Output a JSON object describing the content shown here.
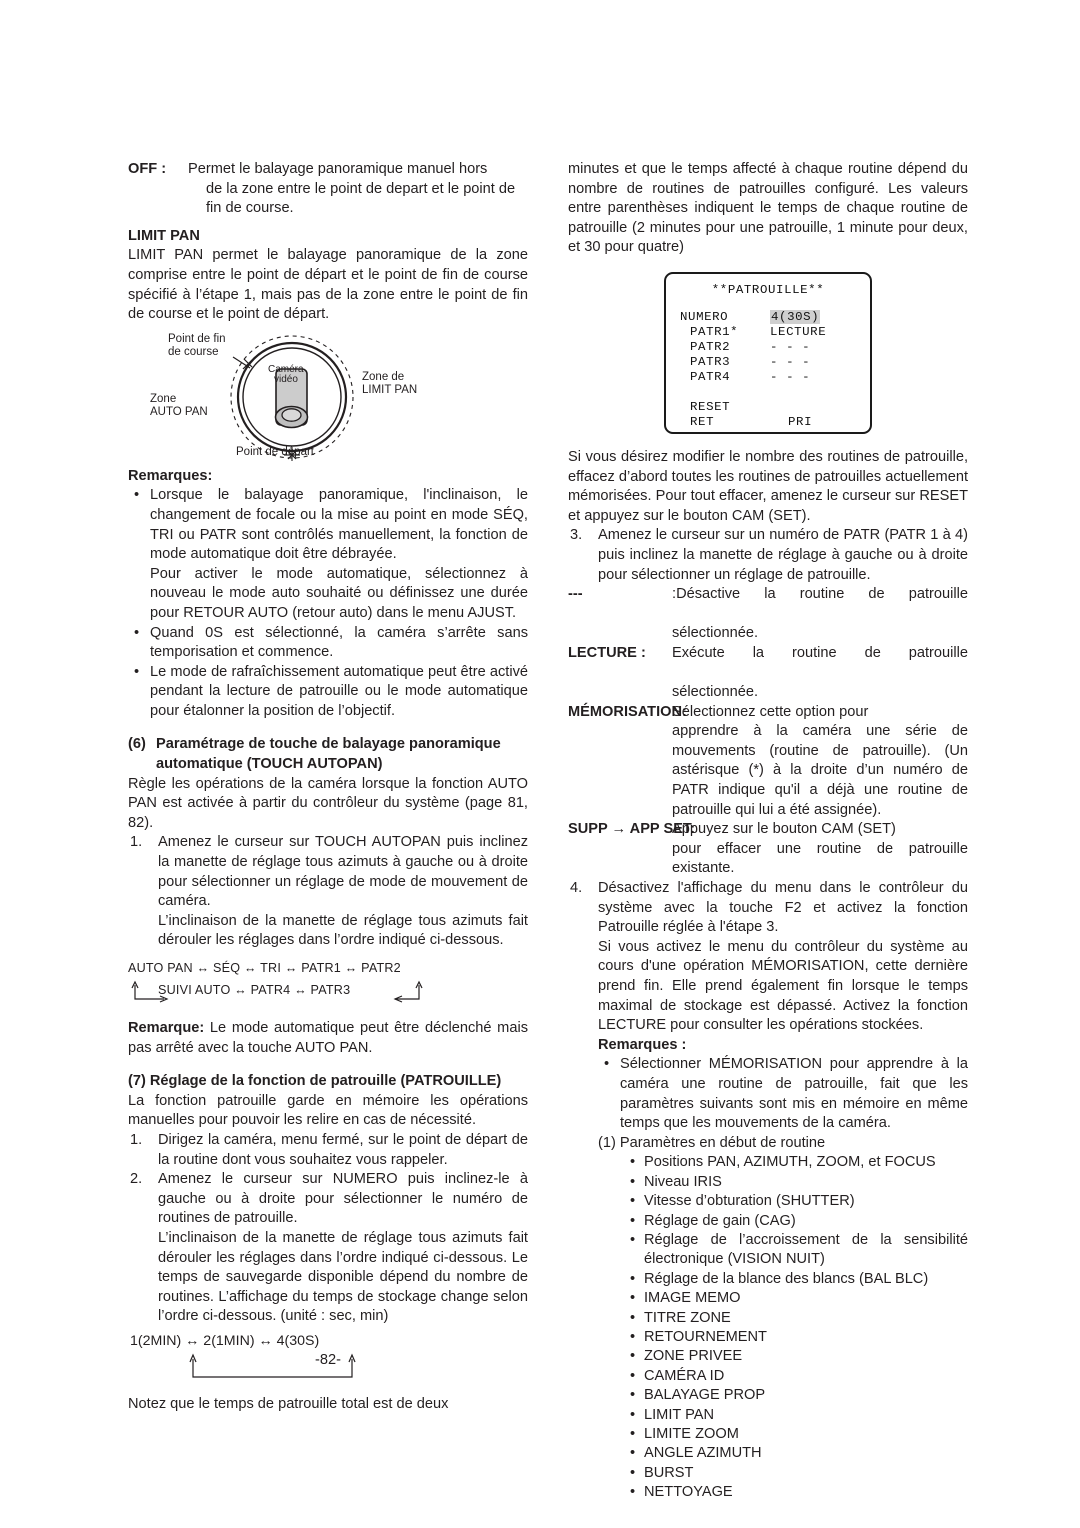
{
  "page_number": "-82-",
  "left_column": {
    "off_definition": {
      "term": "OFF :",
      "line1": "Permet le balayage panoramique manuel hors",
      "line2": "de la zone entre le point de depart et le point de",
      "line3": "fin de course."
    },
    "limit_pan": {
      "heading": "LIMIT PAN",
      "body": "LIMIT PAN permet le balayage panoramique de la zone comprise entre le point de départ et le point de fin de course spécifié à l’étape 1, mais pas de la zone entre le point de fin de course et le point de départ."
    },
    "diagram": {
      "label_end_1": "Point de fin",
      "label_end_2": "de course",
      "label_camera_1": "Caméra",
      "label_camera_2": "vidéo",
      "label_limit_1": "Zone de",
      "label_limit_2": "LIMIT PAN",
      "label_auto_1": "Zone",
      "label_auto_2": "AUTO PAN",
      "label_start": "Point de départ"
    },
    "remarques_heading": "Remarques:",
    "remarques": [
      {
        "p1": "Lorsque le balayage panoramique, l'inclinaison, le changement de focale ou la mise au point en mode SÉQ, TRI ou PATR sont contrôlés manuellement, la fonction de mode automatique doit être débrayée.",
        "p2": "Pour activer le mode automatique, sélectionnez à nouveau le mode auto souhaité ou définissez une durée pour RETOUR AUTO (retour auto) dans le menu AJUST."
      },
      {
        "p1": "Quand 0S est sélectionné, la caméra s’arrête sans temporisation et commence."
      },
      {
        "p1": "Le mode de rafraîchissement automatique peut être activé pendant la lecture de patrouille ou le mode automatique pour étalonner la position de l’objectif."
      }
    ],
    "section6": {
      "number": "(6)",
      "title_line1": "Paramétrage de touche de balayage panoramique",
      "title_line2": "automatique (TOUCH AUTOPAN)",
      "intro": "Règle les opérations de la caméra lorsque la fonction AUTO PAN est activée à partir du contrôleur du système (page 81, 82).",
      "step1_number": "1.",
      "step1": "Amenez le curseur sur TOUCH AUTOPAN puis inclinez la manette de réglage tous azimuts à gauche ou à droite pour sélectionner un réglage de mode de mouvement de caméra.",
      "step1_cont": "L’inclinaison de la manette de réglage tous azimuts fait dérouler les réglages dans l’ordre indiqué ci-dessous.",
      "flow_row1": "AUTO PAN ↔ SÉQ ↔ TRI ↔ PATR1 ↔ PATR2",
      "flow_row2": "SUIVI AUTO ↔ PATR4 ↔ PATR3",
      "remark_label": "Remarque:",
      "remark_text": "Le mode automatique peut être déclenché mais pas arrêté avec la touche AUTO PAN."
    },
    "section7": {
      "heading": "(7) Réglage de la fonction de patrouille (PATROUILLE)",
      "intro": "La fonction patrouille garde en mémoire les opérations manuelles pour pouvoir les relire en cas de nécessité.",
      "step1_number": "1.",
      "step1": "Dirigez la caméra, menu fermé, sur le point de départ de la routine dont vous souhaitez vous rappeler.",
      "step2_number": "2.",
      "step2": "Amenez le curseur sur NUMERO puis inclinez-le à gauche ou à droite pour sélectionner le numéro de routines de patrouille.",
      "step2_cont": "L’inclinaison de la manette de réglage tous azimuts fait dérouler les réglages dans l’ordre indiqué ci-dessous. Le temps de sauvegarde disponible dépend du nombre de routines. L’affichage du temps de stockage change selon l’ordre ci-dessous. (unité : sec, min)",
      "time_flow": "1(2MIN)  ↔  2(1MIN)  ↔  4(30S)",
      "closing": "Notez que le temps de patrouille total est de deux"
    }
  },
  "right_column": {
    "top_paragraph": "minutes et que le temps affecté à chaque routine dépend du nombre de routines de patrouilles configuré. Les valeurs entre parenthèses indiquent le temps de chaque routine de patrouille (2 minutes pour une patrouille, 1 minute pour deux, et 30 pour quatre)",
    "osd_menu": {
      "title": "**PATROUILLE**",
      "rows": [
        {
          "label": "NUMERO",
          "value": "4(30S)",
          "highlighted": true
        },
        {
          "label": "PATR1*",
          "value": "LECTURE",
          "highlighted": false
        },
        {
          "label": "PATR2",
          "value": "- - -",
          "highlighted": false
        },
        {
          "label": "PATR3",
          "value": "- - -",
          "highlighted": false
        },
        {
          "label": "PATR4",
          "value": "- - -",
          "highlighted": false
        }
      ],
      "reset_label": "RESET",
      "ret_label": "RET",
      "pri_label": "PRI"
    },
    "after_menu": "Si vous désirez modifier le nombre des routines de patrouille, effacez d’abord toutes les routines de patrouilles actuellement mémorisées. Pour tout effacer, amenez le curseur sur RESET et appuyez sur le bouton CAM (SET).",
    "step3_number": "3.",
    "step3": "Amenez le curseur sur un numéro de PATR (PATR 1 à 4) puis inclinez la manette de réglage à gauche ou à droite pour sélectionner un réglage de patrouille.",
    "options": [
      {
        "term": "---",
        "sep": ":",
        "text_line1": "Désactive la routine de patrouille",
        "text_line2": "sélectionnée."
      },
      {
        "term": "LECTURE :",
        "text_line1": "Exécute la routine de patrouille",
        "text_line2": "sélectionnée."
      },
      {
        "term": "MÉMORISATION:",
        "text_line1": "Sélectionnez cette option pour",
        "text_rest": "apprendre à la caméra une série de mouvements (routine de patrouille). (Un astérisque (*) à la droite d’un numéro de PATR indique qu'il a déjà une routine de patrouille qui lui a été assignée)."
      },
      {
        "term_a": "SUPP",
        "term_arrow": "→",
        "term_b": "APP SET:",
        "text_line1": "Appuyez sur le bouton CAM (SET)",
        "text_rest": "pour effacer une routine de patrouille existante."
      }
    ],
    "step4_number": "4.",
    "step4": "Désactivez l'affichage du menu dans le contrôleur du système avec la touche F2 et activez la fonction Patrouille réglée à l'étape 3.",
    "step4_cont": "Si vous activez le menu du contrôleur du système au cours d'une opération MÉMORISATION, cette dernière prend fin. Elle prend également fin lorsque le temps maximal de stockage est dépassé. Activez la fonction LECTURE pour consulter les opérations stockées.",
    "remarques_heading": "Remarques :",
    "remarque_bullet": "Sélectionner MÉMORISATION pour apprendre à la caméra une routine de patrouille, fait que les paramètres suivants sont mis en mémoire en même temps que les mouvements de la caméra.",
    "sub_heading": "(1) Paramètres en début de routine",
    "params": [
      "Positions PAN, AZIMUTH, ZOOM, et FOCUS",
      "Niveau IRIS",
      "Vitesse d’obturation (SHUTTER)",
      "Réglage de gain (CAG)",
      "Réglage de l’accroissement de la sensibilité électronique (VISION NUIT)",
      "Réglage de la blance des blancs (BAL BLC)",
      "IMAGE MEMO",
      "TITRE ZONE",
      "RETOURNEMENT",
      "ZONE PRIVEE",
      "CAMÉRA ID",
      "BALAYAGE PROP",
      "LIMIT PAN",
      "LIMITE ZOOM",
      "ANGLE AZIMUTH",
      "BURST",
      "NETTOYAGE"
    ]
  }
}
